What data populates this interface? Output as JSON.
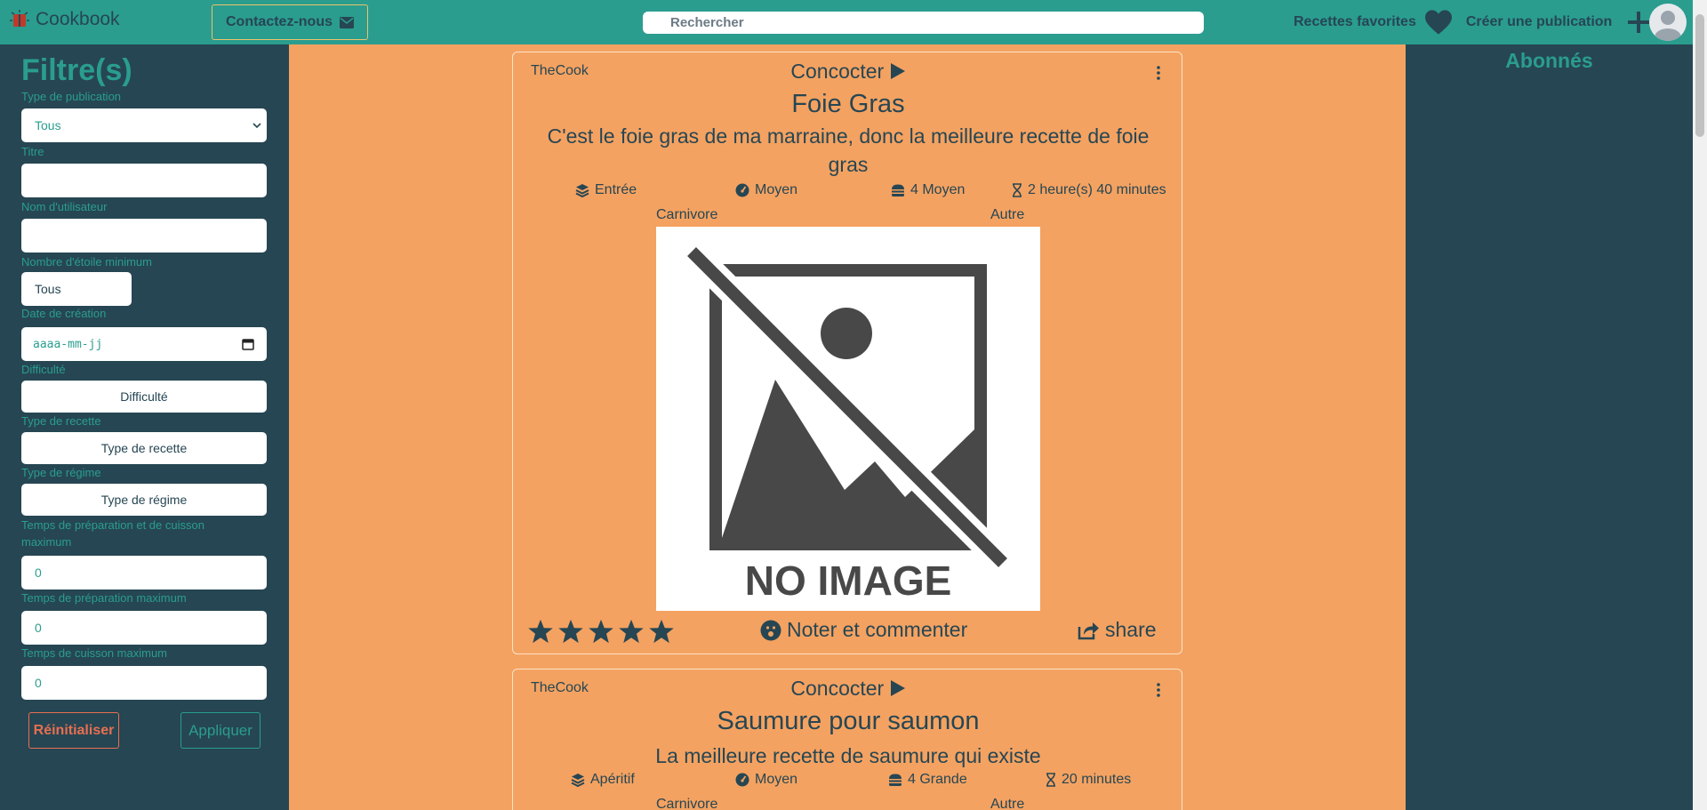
{
  "header": {
    "brand": "Cookbook",
    "contact_label": "Contactez-nous",
    "search_placeholder": "Rechercher",
    "favorites_label": "Recettes favorites",
    "create_label": "Créer une publication"
  },
  "filters": {
    "title": "Filtre(s)",
    "publication_type_label": "Type de publication",
    "publication_type_value": "Tous",
    "title_label": "Titre",
    "title_value": "",
    "username_label": "Nom d'utilisateur",
    "username_value": "",
    "min_stars_label": "Nombre d'étoile minimum",
    "min_stars_value": "Tous",
    "creation_date_label": "Date de création",
    "creation_date_placeholder": "aaaa-mm-jj",
    "difficulty_label": "Difficulté",
    "difficulty_button": "Difficulté",
    "recipe_type_label": "Type de recette",
    "recipe_type_button": "Type de recette",
    "diet_type_label": "Type de régime",
    "diet_type_button": "Type de régime",
    "prep_cook_time_label": "Temps de préparation et de cuisson maximum",
    "prep_cook_time_value": "0",
    "prep_time_label": "Temps de préparation maximum",
    "prep_time_value": "0",
    "cook_time_label": "Temps de cuisson maximum",
    "cook_time_value": "0",
    "reset_label": "Réinitialiser",
    "apply_label": "Appliquer"
  },
  "subscribers": {
    "title": "Abonnés"
  },
  "posts": [
    {
      "author": "TheCook",
      "action": "Concocter",
      "title": "Foie Gras",
      "description": "C'est le foie gras de ma marraine, donc la meilleure recette de foie gras",
      "type": "Entrée",
      "difficulty": "Moyen",
      "portions": "4 Moyen",
      "duration": "2 heure(s) 40 minutes",
      "diet": "Carnivore",
      "category": "Autre",
      "image_text": "NO IMAGE",
      "rating": 5,
      "rate_label": "Noter et commenter",
      "share_label": "share"
    },
    {
      "author": "TheCook",
      "action": "Concocter",
      "title": "Saumure pour saumon",
      "description": "La meilleure recette de saumure qui existe",
      "type": "Apéritif",
      "difficulty": "Moyen",
      "portions": "4 Grande",
      "duration": "20 minutes",
      "diet": "Carnivore",
      "category": "Autre"
    }
  ],
  "colors": {
    "primary": "#2a9d8f",
    "dark": "#264653",
    "accent": "#f4a261",
    "danger": "#e76f51"
  }
}
